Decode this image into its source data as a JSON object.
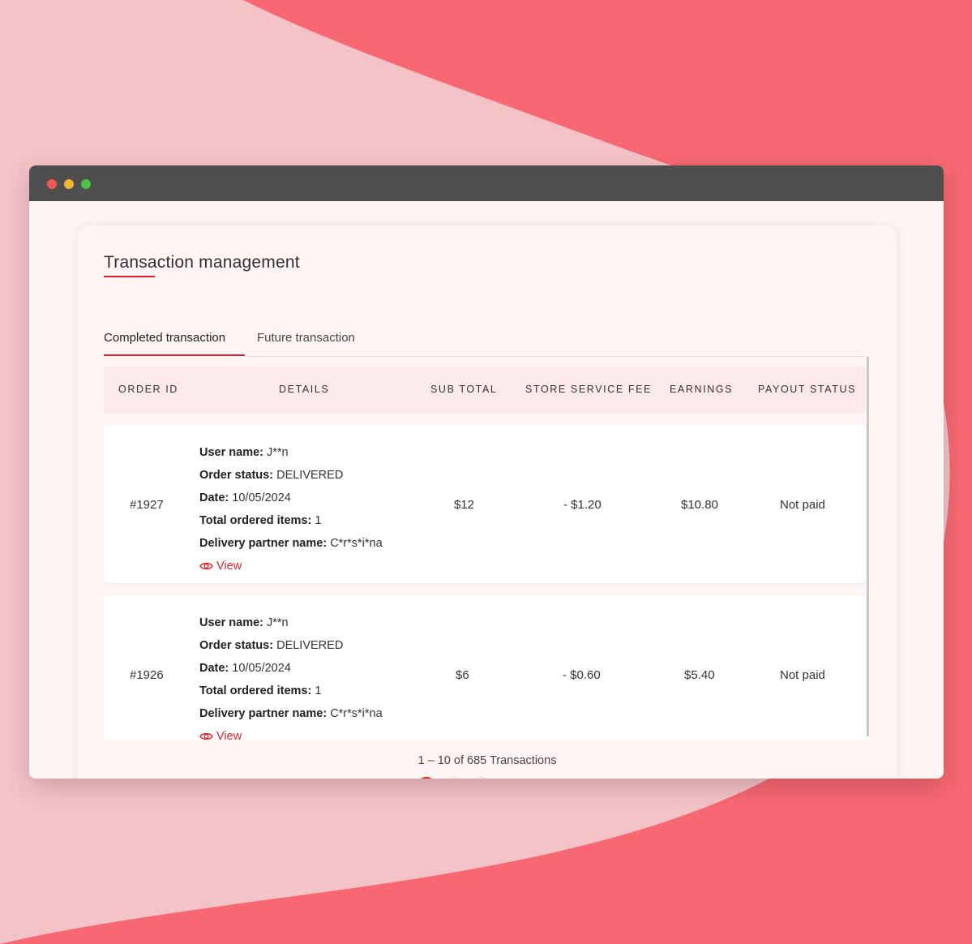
{
  "page": {
    "title": "Transaction management",
    "tabs": [
      {
        "label": "Completed transaction",
        "active": true
      },
      {
        "label": "Future transaction",
        "active": false
      }
    ]
  },
  "table": {
    "headers": [
      "ORDER ID",
      "DETAILS",
      "SUB TOTAL",
      "STORE SERVICE FEE",
      "EARNINGS",
      "PAYOUT STATUS"
    ],
    "labels": {
      "user_name": "User name:",
      "order_status": "Order status:",
      "date": "Date:",
      "total_items": "Total ordered items:",
      "delivery_partner": "Delivery partner name:",
      "view": "View"
    },
    "rows": [
      {
        "order_id": "#1927",
        "user_name": "J**n",
        "order_status": "DELIVERED",
        "date": "10/05/2024",
        "total_items": "1",
        "delivery_partner": "C*r*s*i*na",
        "sub_total": "$12",
        "store_service_fee": "- $1.20",
        "earnings": "$10.80",
        "payout_status": "Not paid"
      },
      {
        "order_id": "#1926",
        "user_name": "J**n",
        "order_status": "DELIVERED",
        "date": "10/05/2024",
        "total_items": "1",
        "delivery_partner": "C*r*s*i*na",
        "sub_total": "$6",
        "store_service_fee": "- $0.60",
        "earnings": "$5.40",
        "payout_status": "Not paid"
      }
    ]
  },
  "pagination": {
    "summary": "1 – 10 of 685 Transactions"
  },
  "colors": {
    "accent": "#e11d2a",
    "background": "#f76872",
    "background_wave": "#f4c3c7",
    "titlebar": "#4f4f4f",
    "window_dot_red": "#ed5b52",
    "window_dot_yellow": "#f2b635",
    "window_dot_green": "#4cc248"
  },
  "icons": {
    "view": "eye-icon"
  }
}
